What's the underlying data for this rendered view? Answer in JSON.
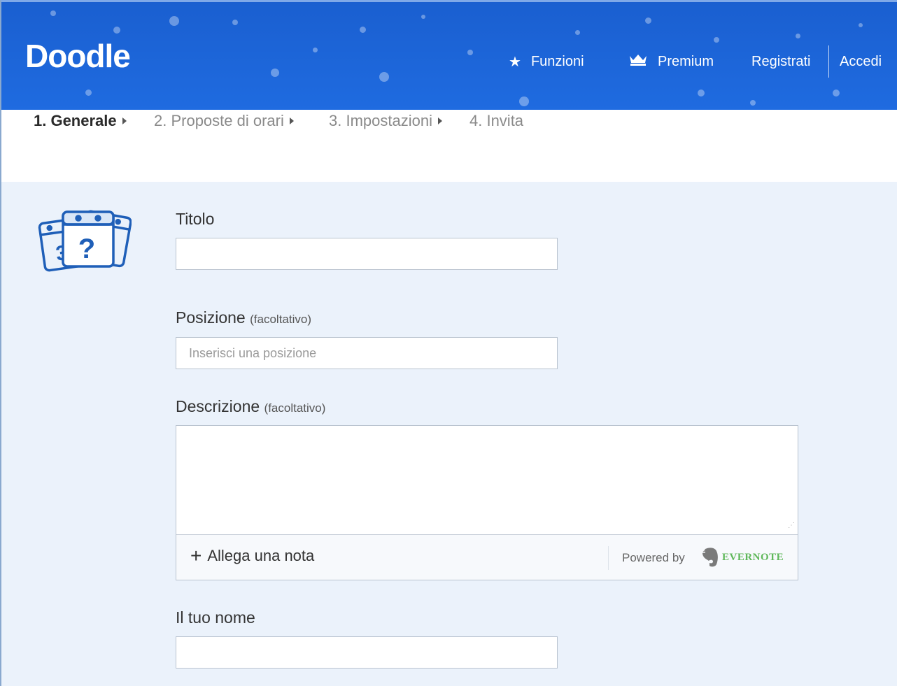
{
  "header": {
    "logo": "Doodle",
    "nav": {
      "funzioni": "Funzioni",
      "premium": "Premium",
      "registrati": "Registrati",
      "accedi": "Accedi"
    }
  },
  "steps": [
    {
      "label": "1. Generale",
      "active": true
    },
    {
      "label": "2. Proposte di orari",
      "active": false
    },
    {
      "label": "3. Impostazioni",
      "active": false
    },
    {
      "label": "4. Invita",
      "active": false
    }
  ],
  "form": {
    "titolo_label": "Titolo",
    "titolo_value": "",
    "posizione_label": "Posizione",
    "posizione_optional": "(facoltativo)",
    "posizione_placeholder": "Inserisci una posizione",
    "descrizione_label": "Descrizione",
    "descrizione_optional": "(facoltativo)",
    "descrizione_value": "",
    "attach_note": "Allega una nota",
    "powered_by": "Powered by",
    "evernote": "EVERNOTE",
    "nome_label": "Il tuo nome",
    "nome_value": ""
  },
  "colors": {
    "header_blue": "#1f6be0",
    "form_background": "#ebf2fb",
    "evernote_green": "#5fb85a"
  },
  "icons": [
    "star-icon",
    "crown-icon",
    "calendar-question-icon",
    "plus-icon",
    "evernote-elephant-icon"
  ]
}
